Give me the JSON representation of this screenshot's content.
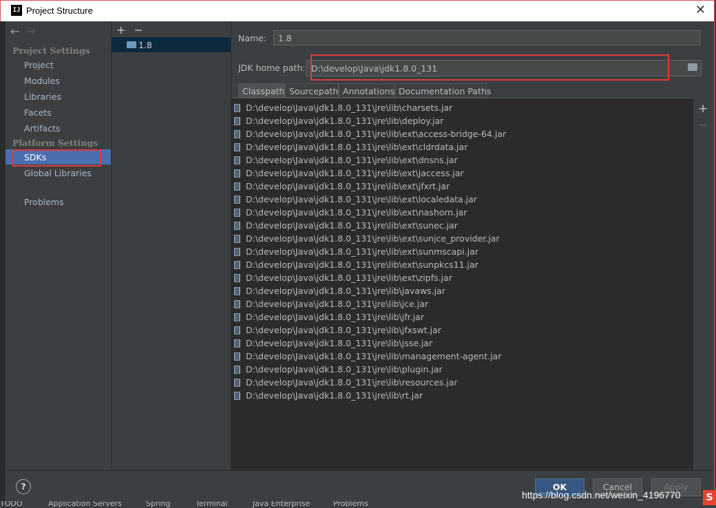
{
  "window": {
    "title": "Project Structure",
    "app_icon": "IJ",
    "close_glyph": "✕"
  },
  "left_panel": {
    "nav_back": "←",
    "nav_forward": "→",
    "project_settings_header": "Project Settings",
    "project_items": [
      "Project",
      "Modules",
      "Libraries",
      "Facets",
      "Artifacts"
    ],
    "platform_settings_header": "Platform Settings",
    "platform_items": [
      "SDKs",
      "Global Libraries"
    ],
    "problems": "Problems",
    "selected": "SDKs"
  },
  "mid_panel": {
    "add": "+",
    "remove": "−",
    "sdk_label": "1.8"
  },
  "form": {
    "name_label": "Name:",
    "name_value": "1.8",
    "home_label": "JDK home path:",
    "home_value": "D:\\develop\\Java\\jdk1.8.0_131"
  },
  "tabs": [
    "Classpath",
    "Sourcepath",
    "Annotations",
    "Documentation Paths"
  ],
  "classpath": [
    "D:\\develop\\Java\\jdk1.8.0_131\\jre\\lib\\charsets.jar",
    "D:\\develop\\Java\\jdk1.8.0_131\\jre\\lib\\deploy.jar",
    "D:\\develop\\Java\\jdk1.8.0_131\\jre\\lib\\ext\\access-bridge-64.jar",
    "D:\\develop\\Java\\jdk1.8.0_131\\jre\\lib\\ext\\cldrdata.jar",
    "D:\\develop\\Java\\jdk1.8.0_131\\jre\\lib\\ext\\dnsns.jar",
    "D:\\develop\\Java\\jdk1.8.0_131\\jre\\lib\\ext\\jaccess.jar",
    "D:\\develop\\Java\\jdk1.8.0_131\\jre\\lib\\ext\\jfxrt.jar",
    "D:\\develop\\Java\\jdk1.8.0_131\\jre\\lib\\ext\\localedata.jar",
    "D:\\develop\\Java\\jdk1.8.0_131\\jre\\lib\\ext\\nashorn.jar",
    "D:\\develop\\Java\\jdk1.8.0_131\\jre\\lib\\ext\\sunec.jar",
    "D:\\develop\\Java\\jdk1.8.0_131\\jre\\lib\\ext\\sunjce_provider.jar",
    "D:\\develop\\Java\\jdk1.8.0_131\\jre\\lib\\ext\\sunmscapi.jar",
    "D:\\develop\\Java\\jdk1.8.0_131\\jre\\lib\\ext\\sunpkcs11.jar",
    "D:\\develop\\Java\\jdk1.8.0_131\\jre\\lib\\ext\\zipfs.jar",
    "D:\\develop\\Java\\jdk1.8.0_131\\jre\\lib\\javaws.jar",
    "D:\\develop\\Java\\jdk1.8.0_131\\jre\\lib\\jce.jar",
    "D:\\develop\\Java\\jdk1.8.0_131\\jre\\lib\\jfr.jar",
    "D:\\develop\\Java\\jdk1.8.0_131\\jre\\lib\\jfxswt.jar",
    "D:\\develop\\Java\\jdk1.8.0_131\\jre\\lib\\jsse.jar",
    "D:\\develop\\Java\\jdk1.8.0_131\\jre\\lib\\management-agent.jar",
    "D:\\develop\\Java\\jdk1.8.0_131\\jre\\lib\\plugin.jar",
    "D:\\develop\\Java\\jdk1.8.0_131\\jre\\lib\\resources.jar",
    "D:\\develop\\Java\\jdk1.8.0_131\\jre\\lib\\rt.jar"
  ],
  "list_tools": {
    "add": "+",
    "remove": "−"
  },
  "buttons": {
    "help": "?",
    "ok": "OK",
    "cancel": "Cancel",
    "apply": "Apply"
  },
  "watermark": "https://blog.csdn.net/weixin_4196770",
  "taskbar": [
    "TODO",
    "Application Servers",
    "Spring",
    "Terminal",
    "Java Enterprise",
    "Problems"
  ],
  "colors": {
    "accent": "#4b6eaf",
    "highlight": "#e03a3a"
  }
}
